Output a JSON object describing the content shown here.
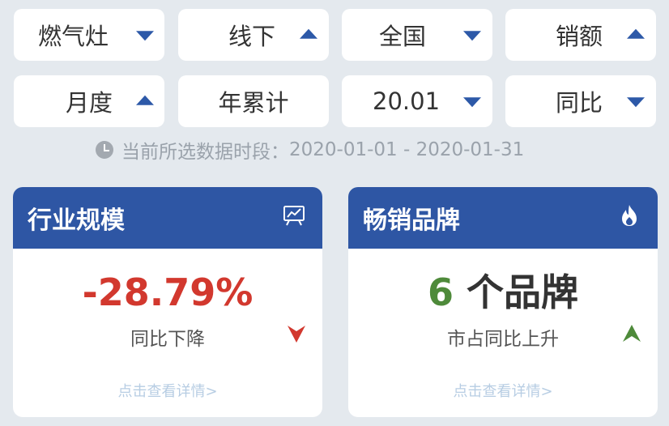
{
  "filters": {
    "row1": [
      {
        "label": "燃气灶",
        "arrow": "down"
      },
      {
        "label": "线下",
        "arrow": "up"
      },
      {
        "label": "全国",
        "arrow": "down"
      },
      {
        "label": "销额",
        "arrow": "up"
      }
    ],
    "row2": [
      {
        "label": "月度",
        "arrow": "up"
      },
      {
        "label": "年累计",
        "arrow": "none"
      },
      {
        "label": "20.01",
        "arrow": "down"
      },
      {
        "label": "同比",
        "arrow": "down"
      }
    ]
  },
  "period": {
    "prefix": "当前所选数据时段：",
    "range": "2020-01-01 - 2020-01-31"
  },
  "cards": {
    "industry": {
      "title": "行业规模",
      "value": "-28.79%",
      "caption": "同比下降",
      "trend": "down",
      "link": "点击查看详情>"
    },
    "brands": {
      "title": "畅销品牌",
      "count": "6",
      "unit": "个品牌",
      "caption": "市占同比上升",
      "trend": "up",
      "link": "点击查看详情>"
    }
  },
  "colors": {
    "accent": "#2e56a4",
    "negative": "#d2382e",
    "positive": "#4e8a3a",
    "link": "#b7cde3"
  }
}
